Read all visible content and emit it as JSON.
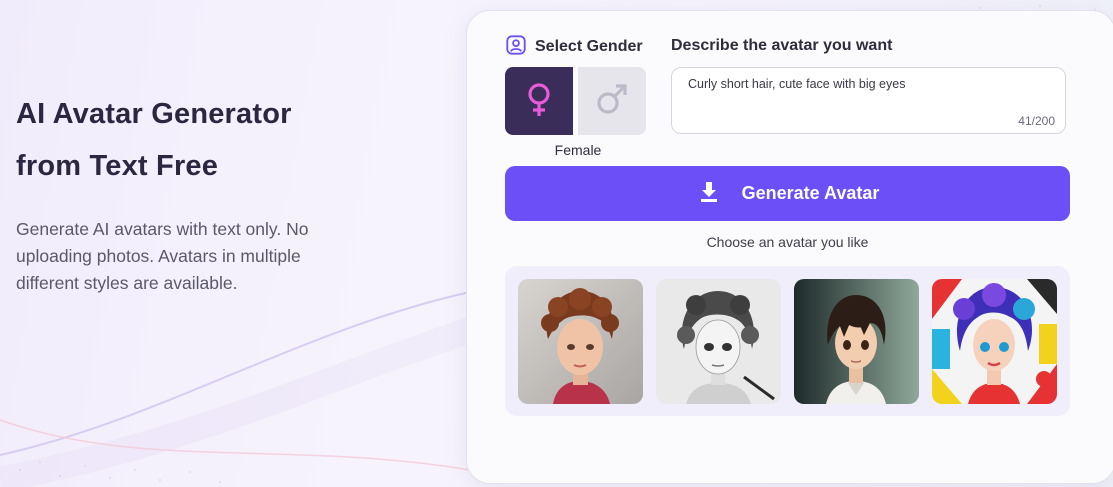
{
  "hero": {
    "title_line1": "AI Avatar Generator",
    "title_line2": "from Text Free",
    "description": "Generate AI avatars with text only. No uploading photos. Avatars in multiple different styles are available."
  },
  "gender": {
    "heading": "Select Gender",
    "selected_caption": "Female",
    "options": [
      {
        "name": "female",
        "icon": "female-symbol-icon",
        "selected": true
      },
      {
        "name": "male",
        "icon": "male-symbol-icon",
        "selected": false
      }
    ]
  },
  "prompt": {
    "heading": "Describe the avatar you want",
    "value": "Curly short hair, cute face with big eyes",
    "counter": "41/200"
  },
  "generate": {
    "label": "Generate Avatar",
    "icon": "download-icon"
  },
  "choose": {
    "label": "Choose an avatar you like"
  },
  "avatars": [
    {
      "style": "realistic",
      "icon": "avatar-realistic-image"
    },
    {
      "style": "sketch",
      "icon": "avatar-sketch-image"
    },
    {
      "style": "anime",
      "icon": "avatar-anime-image"
    },
    {
      "style": "pop-art",
      "icon": "avatar-popart-image"
    }
  ],
  "colors": {
    "accent": "#6c4ff6",
    "female_selected_bg": "#3a2d5a",
    "female_symbol": "#e85ad8",
    "male_bg": "#e6e5ec"
  }
}
